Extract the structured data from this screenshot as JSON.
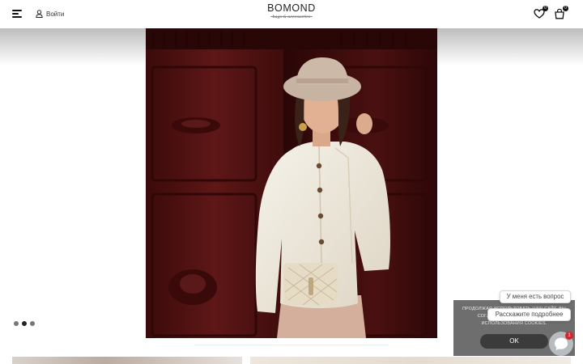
{
  "header": {
    "login_label": "Войти",
    "logo_title": "BOMOND",
    "logo_tagline": "bags & accessories",
    "favorites_count": "0",
    "cart_count": "0"
  },
  "hero": {
    "slide_dots": [
      {
        "active": false
      },
      {
        "active": true
      },
      {
        "active": false
      }
    ],
    "colors": {
      "door": "#5a1414",
      "background": "#2a0808",
      "cardigan": "#efe9dd",
      "hat": "#c9b7a6",
      "skirt": "#d8b6a3"
    }
  },
  "cookie_banner": {
    "text": "ПРОДОЛЖАЯ ИСПОЛЬЗОВАТЬ НАШ САЙТ, ВЫ СОГЛАШАЕТЕСЬ С УСЛОВИЯМИ ИСПОЛЬЗОВАНИЯ COOKIES.",
    "ok_label": "OK"
  },
  "chat": {
    "prompt_1": "У меня есть вопрос",
    "prompt_2": "Расскажите подробнее",
    "unread_count": "1"
  },
  "colors": {
    "text": "#222222",
    "cookie_bg": "#6e6e6e",
    "cookie_button": "#3b3b3b",
    "chat_badge": "#d6262b"
  }
}
